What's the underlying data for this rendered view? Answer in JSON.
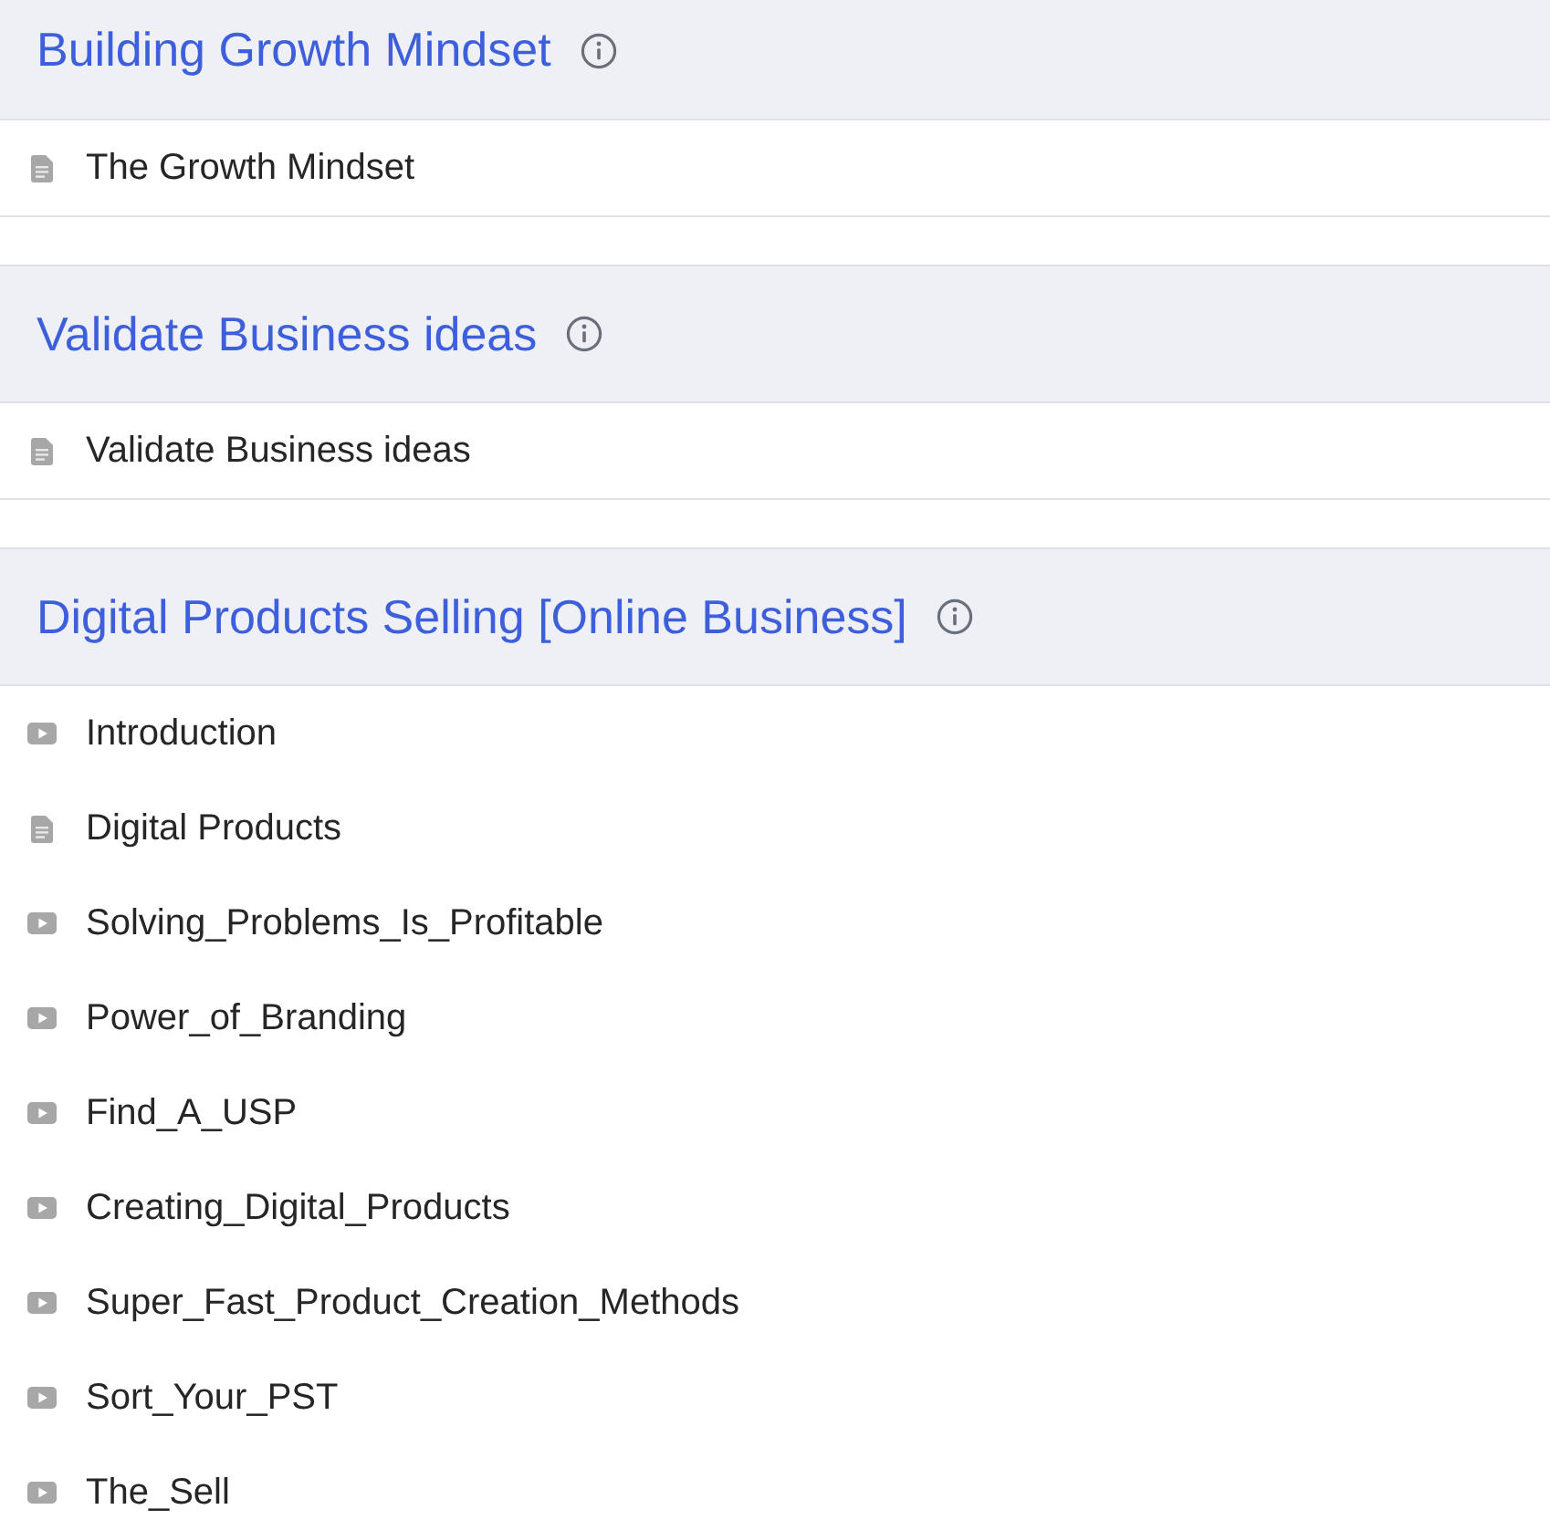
{
  "sections": [
    {
      "title": "Building Growth Mindset",
      "lessons": [
        {
          "kind": "document",
          "title": "The Growth Mindset"
        }
      ]
    },
    {
      "title": "Validate Business ideas",
      "lessons": [
        {
          "kind": "document",
          "title": "Validate Business ideas"
        }
      ]
    },
    {
      "title": "Digital Products Selling [Online Business]",
      "lessons": [
        {
          "kind": "video",
          "title": "Introduction"
        },
        {
          "kind": "document",
          "title": "Digital Products"
        },
        {
          "kind": "video",
          "title": "Solving_Problems_Is_Profitable"
        },
        {
          "kind": "video",
          "title": "Power_of_Branding"
        },
        {
          "kind": "video",
          "title": "Find_A_USP"
        },
        {
          "kind": "video",
          "title": "Creating_Digital_Products"
        },
        {
          "kind": "video",
          "title": "Super_Fast_Product_Creation_Methods"
        },
        {
          "kind": "video",
          "title": "Sort_Your_PST"
        },
        {
          "kind": "video",
          "title": "The_Sell"
        }
      ]
    }
  ]
}
